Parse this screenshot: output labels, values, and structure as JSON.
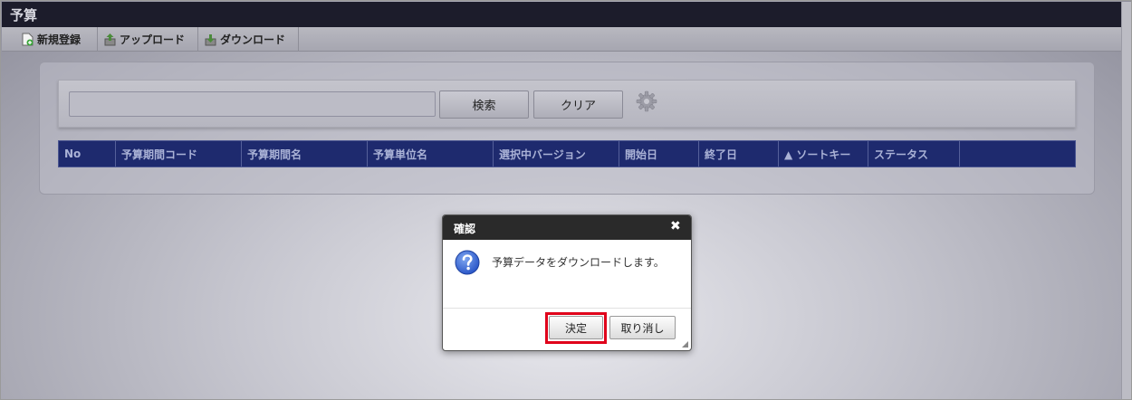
{
  "window": {
    "title": "予算"
  },
  "toolbar": {
    "items": [
      {
        "label": "新規登録",
        "icon": "add-document-icon"
      },
      {
        "label": "アップロード",
        "icon": "upload-icon"
      },
      {
        "label": "ダウンロード",
        "icon": "download-icon"
      }
    ]
  },
  "search": {
    "value": "",
    "placeholder": "",
    "search_button": "検索",
    "clear_button": "クリア",
    "settings_icon": "gear-icon"
  },
  "table": {
    "columns": [
      "No",
      "予算期間コード",
      "予算期間名",
      "予算単位名",
      "選択中バージョン",
      "開始日",
      "終了日",
      "▲ ソートキー",
      "ステータス"
    ],
    "rows": []
  },
  "dialog": {
    "title": "確認",
    "message": "予算データをダウンロードします。",
    "confirm_label": "決定",
    "cancel_label": "取り消し",
    "close_glyph": "✖",
    "icon": "question-icon"
  },
  "colors": {
    "title_bar": "#1c1c2b",
    "grid_header": "#1e2a6e",
    "highlight": "#e0001a",
    "question_icon": "#2b57c8"
  }
}
